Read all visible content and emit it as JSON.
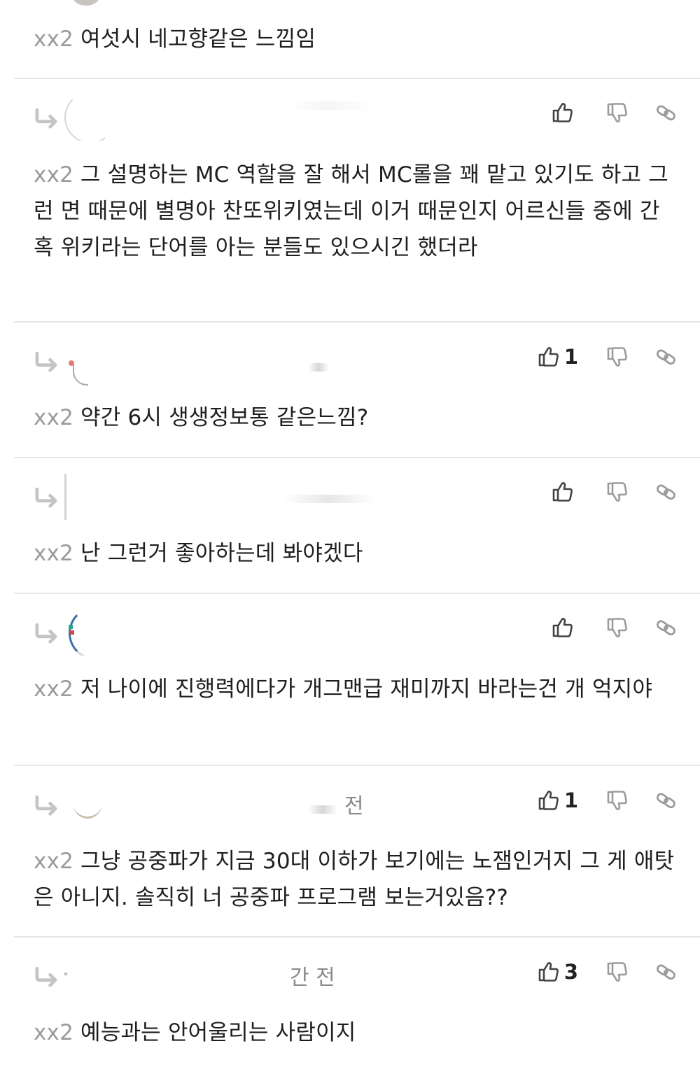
{
  "colors": {
    "mention": "#9a9a9a",
    "divider": "#e6e6e6",
    "icon": "#444444",
    "icon_muted": "#9b9b9b"
  },
  "icons": {
    "reply": "reply-arrow-icon",
    "like": "thumbs-up-icon",
    "dislike": "thumbs-down-icon",
    "share": "link-icon"
  },
  "top_comment": {
    "mention": "xx2",
    "text": "여섯시 네고향같은 느낌임"
  },
  "replies": [
    {
      "time": "",
      "likes": "",
      "mention": "xx2",
      "text": "그 설명하는 MC 역할을 잘 해서 MC롤을 꽤 맡고 있기도 하고 그런 면 때문에 별명아 찬또위키였는데 이거 때문인지 어르신들 중에 간혹 위키라는 단어를 아는 분들도 있으시긴 했더라"
    },
    {
      "time": "",
      "likes": "1",
      "mention": "xx2",
      "text": "약간 6시 생생정보통 같은느낌?"
    },
    {
      "time": "",
      "likes": "",
      "mention": "xx2",
      "text": "난 그런거 좋아하는데 봐야겠다"
    },
    {
      "time": "",
      "likes": "",
      "mention": "xx2",
      "text": "저 나이에 진행력에다가 개그맨급 재미까지 바라는건 개 억지야"
    },
    {
      "time": "전",
      "likes": "1",
      "mention": "xx2",
      "text": "그냥 공중파가 지금 30대 이하가 보기에는 노잼인거지 그 게 애탓은 아니지. 솔직히 너 공중파 프로그램 보는거있음??"
    },
    {
      "time": "간 전",
      "likes": "3",
      "mention": "xx2",
      "text": "예능과는 안어울리는 사람이지"
    }
  ]
}
